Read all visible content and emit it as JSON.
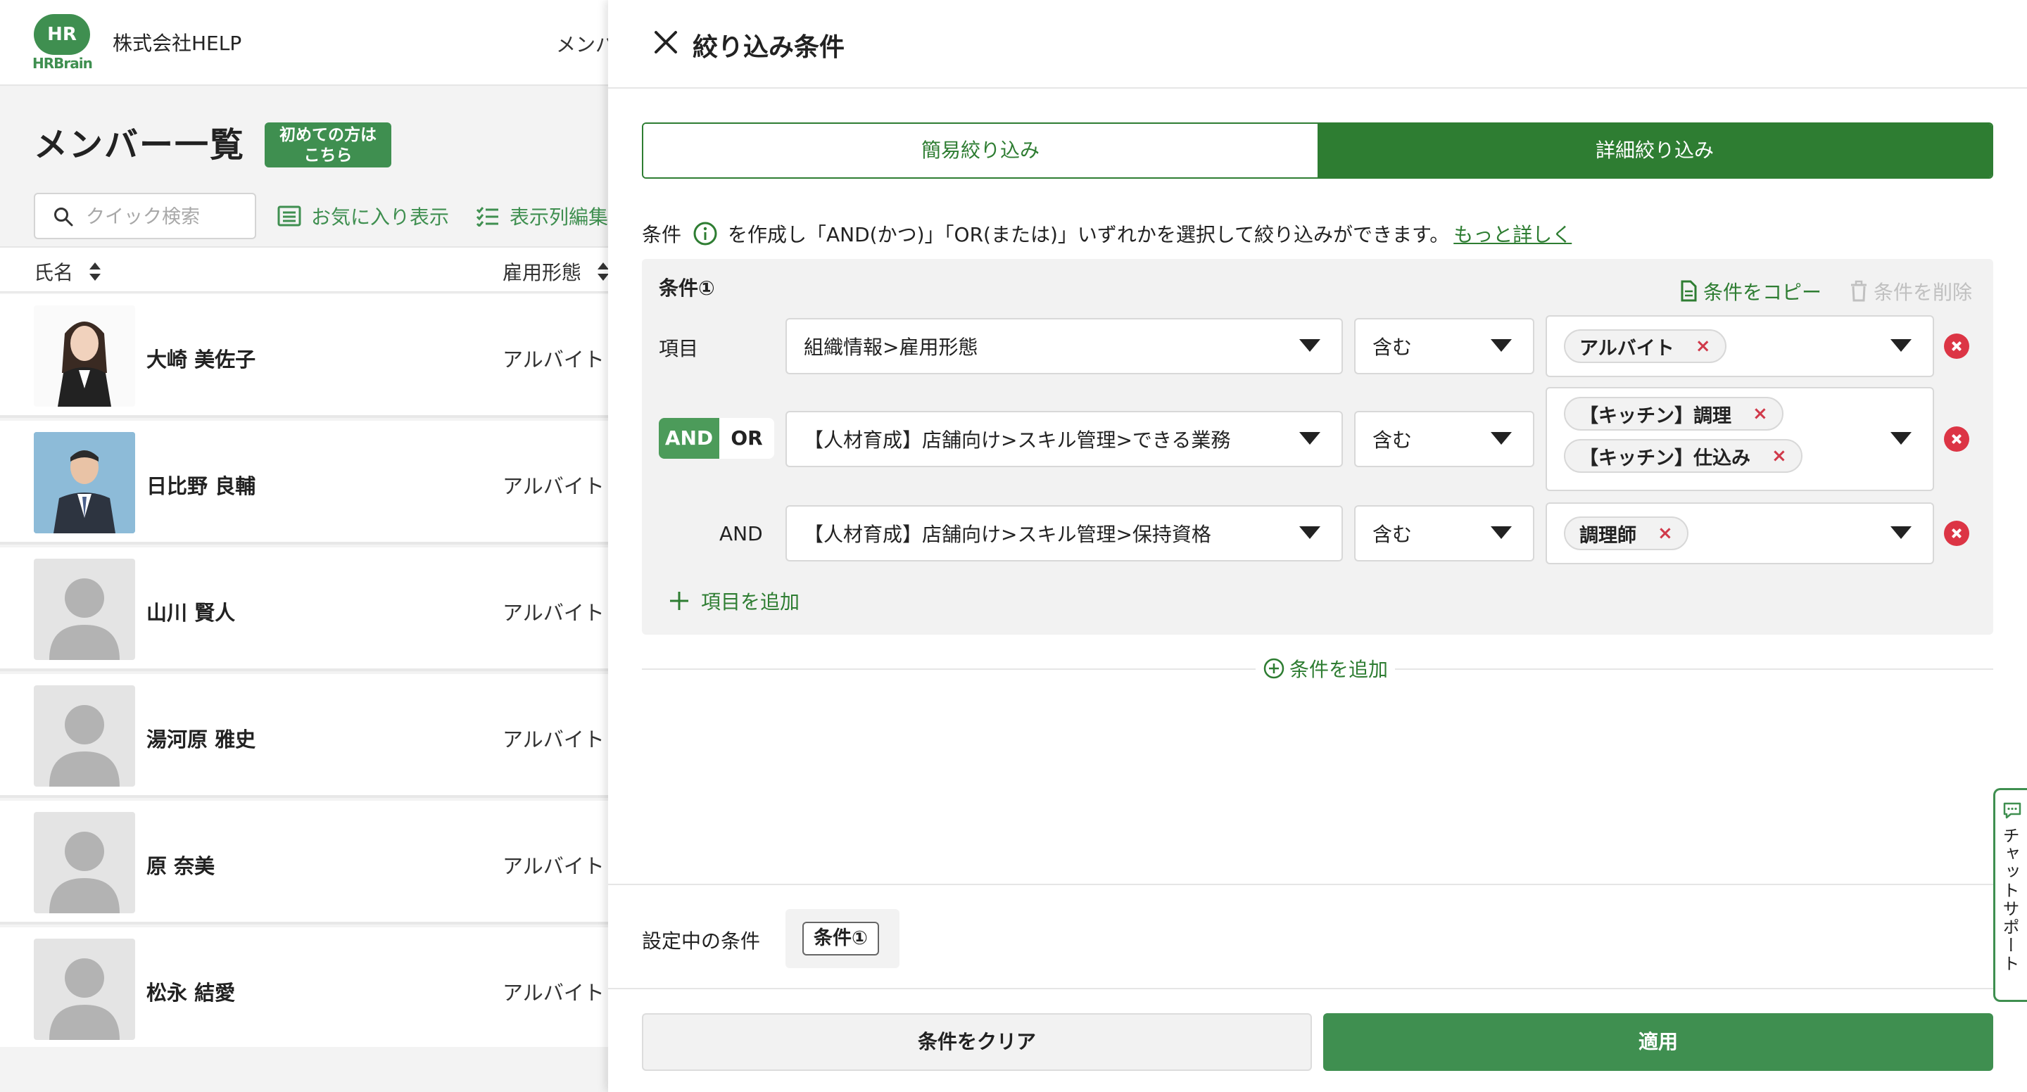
{
  "app": {
    "logo_badge": "HR",
    "logo_word": "HRBrain",
    "company": "株式会社HELP",
    "nav_partial": "メンバ"
  },
  "list": {
    "title": "メンバー一覧",
    "first_time_badge": "初めての方は\nこちら",
    "search_placeholder": "クイック検索",
    "favorites_label": "お気に入り表示",
    "columns_label": "表示列編集",
    "headers": {
      "name": "氏名",
      "employment": "雇用形態"
    },
    "rows": [
      {
        "name": "大崎 美佐子",
        "employment": "アルバイト",
        "avatar": "photo-woman"
      },
      {
        "name": "日比野 良輔",
        "employment": "アルバイト",
        "avatar": "photo-man"
      },
      {
        "name": "山川 賢人",
        "employment": "アルバイト",
        "avatar": "placeholder"
      },
      {
        "name": "湯河原 雅史",
        "employment": "アルバイト",
        "avatar": "placeholder"
      },
      {
        "name": "原 奈美",
        "employment": "アルバイト",
        "avatar": "placeholder"
      },
      {
        "name": "松永 結愛",
        "employment": "アルバイト",
        "avatar": "placeholder"
      }
    ]
  },
  "drawer": {
    "title": "絞り込み条件",
    "tabs": {
      "simple": "簡易絞り込み",
      "detail": "詳細絞り込み",
      "active": "detail"
    },
    "help": {
      "prefix": "条件",
      "text": "を作成し「AND(かつ)」「OR(または)」いずれかを選択して絞り込みができます。",
      "link": "もっと詳しく"
    },
    "condition": {
      "label": "条件①",
      "copy_label": "条件をコピー",
      "delete_label": "条件を削除",
      "row_label": "項目",
      "logic": {
        "and": "AND",
        "or": "OR",
        "selected": "AND",
        "and_label": "AND"
      },
      "rows": [
        {
          "field": "組織情報>雇用形態",
          "operator": "含む",
          "values": [
            "アルバイト"
          ]
        },
        {
          "field": "【人材育成】店舗向け>スキル管理>できる業務",
          "operator": "含む",
          "values": [
            "【キッチン】調理",
            "【キッチン】仕込み"
          ]
        },
        {
          "field": "【人材育成】店舗向け>スキル管理>保持資格",
          "operator": "含む",
          "values": [
            "調理師"
          ]
        }
      ],
      "add_item_label": "項目を追加"
    },
    "add_condition_label": "条件を追加",
    "active_conditions_label": "設定中の条件",
    "active_conditions": [
      "条件①"
    ],
    "clear_label": "条件をクリア",
    "apply_label": "適用"
  },
  "chat_support": "チャットサポート",
  "colors": {
    "brand": "#3f8f50",
    "brand_dark": "#2e7d32",
    "remove": "#dc3545"
  }
}
